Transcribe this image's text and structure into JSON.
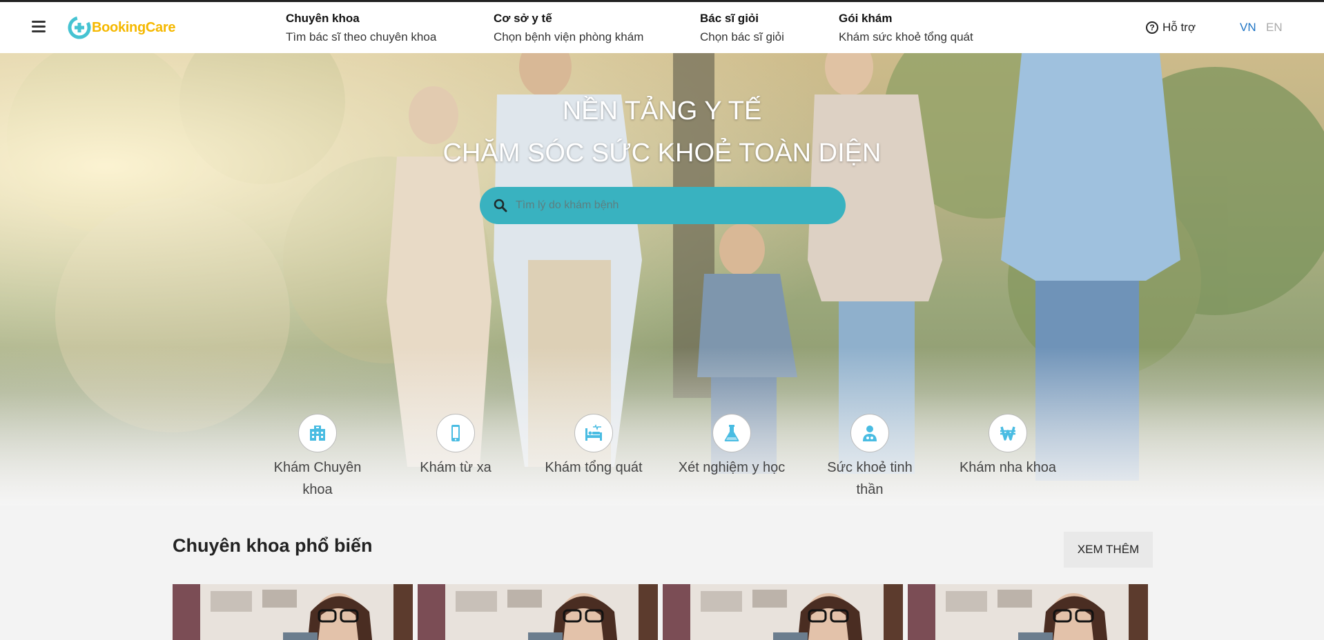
{
  "header": {
    "logo_text": "BookingCare",
    "nav": [
      {
        "title": "Chuyên khoa",
        "subtitle": "Tìm bác sĩ theo chuyên khoa"
      },
      {
        "title": "Cơ sở y tế",
        "subtitle": "Chọn bệnh viện phòng khám"
      },
      {
        "title": "Bác sĩ giỏi",
        "subtitle": "Chọn bác sĩ giỏi"
      },
      {
        "title": "Gói khám",
        "subtitle": "Khám sức khoẻ tổng quát"
      }
    ],
    "support_label": "Hỗ trợ",
    "languages": {
      "vn": "VN",
      "en": "EN"
    }
  },
  "hero": {
    "title_line1": "NỀN TẢNG Y TẾ",
    "title_line2": "CHĂM SÓC SỨC KHOẺ TOÀN DIỆN",
    "search_placeholder": "Tìm lý do khám bệnh"
  },
  "services": [
    {
      "label": "Khám Chuyên khoa",
      "icon": "hospital-icon"
    },
    {
      "label": "Khám từ xa",
      "icon": "phone-icon"
    },
    {
      "label": "Khám tổng quát",
      "icon": "bed-icon"
    },
    {
      "label": "Xét nghiệm y học",
      "icon": "flask-icon"
    },
    {
      "label": "Sức khoẻ tinh thần",
      "icon": "mind-icon"
    },
    {
      "label": "Khám nha khoa",
      "icon": "tooth-icon"
    }
  ],
  "section": {
    "title": "Chuyên khoa phổ biến",
    "more_label": "XEM THÊM"
  },
  "colors": {
    "accent": "#39b2c0",
    "logo_yellow": "#f5b800",
    "logo_blue": "#45c3d2",
    "lang_active": "#1e74c4",
    "service_icon": "#49bce2"
  }
}
